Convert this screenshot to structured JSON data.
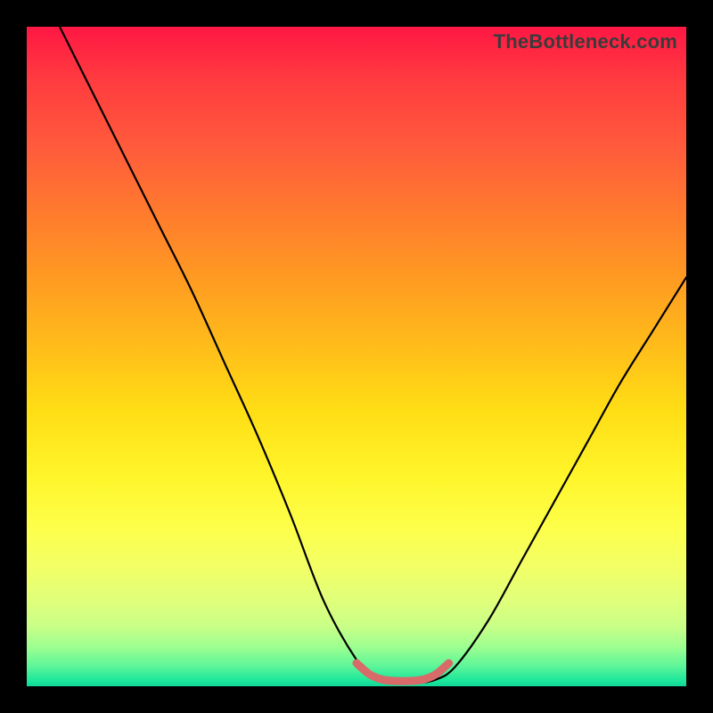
{
  "watermark": "TheBottleneck.com",
  "chart_data": {
    "type": "line",
    "title": "",
    "xlabel": "",
    "ylabel": "",
    "xlim": [
      0,
      100
    ],
    "ylim": [
      0,
      100
    ],
    "series": [
      {
        "name": "bottleneck-curve",
        "color": "#000000",
        "x": [
          5,
          10,
          15,
          20,
          25,
          30,
          35,
          40,
          45,
          50,
          53,
          56,
          59,
          62,
          65,
          70,
          75,
          80,
          85,
          90,
          95,
          100
        ],
        "values": [
          100,
          90,
          80,
          70,
          60,
          49,
          38,
          26,
          13,
          4,
          1,
          0.5,
          0.5,
          1,
          3,
          10,
          19,
          28,
          37,
          46,
          54,
          62
        ]
      },
      {
        "name": "optimal-band",
        "color": "#e06666",
        "x": [
          50,
          52,
          54,
          56,
          58,
          60,
          62,
          64
        ],
        "values": [
          3.5,
          1.8,
          1.0,
          0.8,
          0.8,
          1.0,
          1.8,
          3.5
        ]
      }
    ],
    "gradient_stops": [
      {
        "pos": 0,
        "color": "#ff1744"
      },
      {
        "pos": 50,
        "color": "#ffdd15"
      },
      {
        "pos": 100,
        "color": "#10d898"
      }
    ]
  }
}
